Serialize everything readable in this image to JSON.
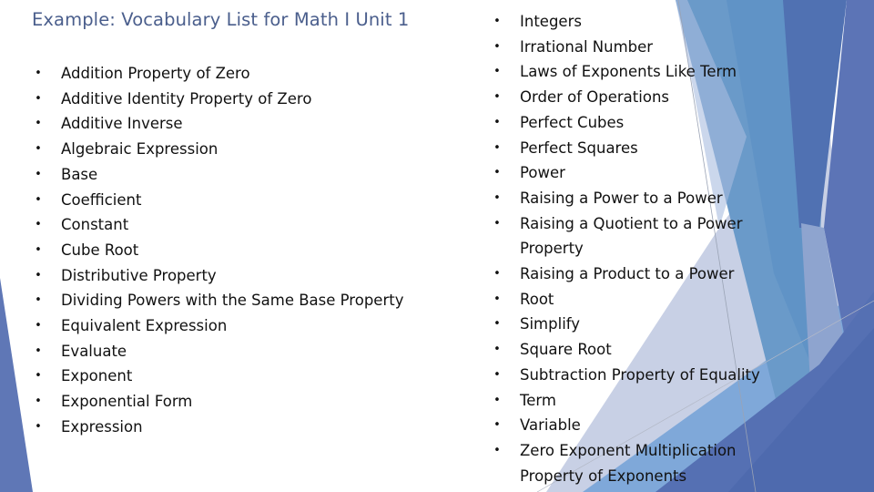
{
  "slide": {
    "title": "Example: Vocabulary List for Math I Unit 1",
    "bullet_glyph": "•",
    "left_column": [
      "Addition Property of Zero",
      "Additive Identity Property of Zero",
      "Additive Inverse",
      "Algebraic Expression",
      "Base",
      "Coefficient",
      "Constant",
      "Cube Root",
      "Distributive Property",
      "Dividing Powers with the Same Base Property",
      "Equivalent Expression",
      "Evaluate",
      "Exponent",
      "Exponential Form",
      "Expression"
    ],
    "right_column": [
      {
        "line1": "Integers",
        "line2": ""
      },
      {
        "line1": "Irrational Number",
        "line2": ""
      },
      {
        "line1": "Laws of Exponents Like Term",
        "line2": ""
      },
      {
        "line1": "Order of Operations",
        "line2": ""
      },
      {
        "line1": "Perfect Cubes",
        "line2": ""
      },
      {
        "line1": "Perfect Squares",
        "line2": ""
      },
      {
        "line1": "Power",
        "line2": ""
      },
      {
        "line1": "Raising a Power to a Power",
        "line2": ""
      },
      {
        "line1": "Raising a Quotient to a Power",
        "line2": "Property"
      },
      {
        "line1": "Raising a Product to a Power",
        "line2": ""
      },
      {
        "line1": "Root",
        "line2": ""
      },
      {
        "line1": "Simplify",
        "line2": ""
      },
      {
        "line1": "Square Root",
        "line2": ""
      },
      {
        "line1": "Subtraction Property of Equality",
        "line2": ""
      },
      {
        "line1": "Term",
        "line2": ""
      },
      {
        "line1": "Variable",
        "line2": ""
      },
      {
        "line1": "Zero Exponent Multiplication",
        "line2": "Property of Exponents"
      }
    ]
  },
  "theme": {
    "title_color": "#4a5e8c",
    "text_color": "#111111",
    "accent_colors": [
      "#5b75b5",
      "#6a9ac9",
      "#5a8fc4",
      "#4e6fb0",
      "#b7c3de",
      "#8eb2dd",
      "#7ca7d8"
    ]
  }
}
